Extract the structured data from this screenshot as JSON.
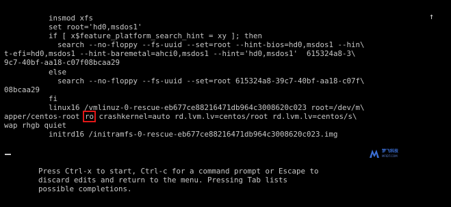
{
  "boot_editor": {
    "lines": [
      "          insmod xfs",
      "          set root='hd0,msdos1'",
      "          if [ x$feature_platform_search_hint = xy ]; then",
      "            search --no-floppy --fs-uuid --set=root --hint-bios=hd0,msdos1 --hin\\",
      "t-efi=hd0,msdos1 --hint-baremetal=ahci0,msdos1 --hint='hd0,msdos1'  615324a8-3\\",
      "9c7-40bf-aa18-c07f08bcaa29",
      "          else",
      "            search --no-floppy --fs-uuid --set=root 615324a8-39c7-40bf-aa18-c07f\\",
      "08bcaa29",
      "          fi",
      "          linux16 /vmlinuz-0-rescue-eb677ce88216471db964c3008620c023 root=/dev/m\\"
    ],
    "highlight_line": {
      "prefix": "apper/centos-root ",
      "highlighted": "ro",
      "suffix": " crashkernel=auto rd.lvm.lv=centos/root rd.lvm.lv=centos/s\\"
    },
    "after_lines": [
      "wap rhgb quiet",
      "          initrd16 /initramfs-0-rescue-eb677ce88216471db964c3008620c023.img"
    ]
  },
  "scroll_indicator": "↑",
  "help_lines": [
    "Press Ctrl-x to start, Ctrl-c for a command prompt or Escape to",
    "discard edits and return to the menu. Pressing Tab lists",
    "possible completions."
  ],
  "watermark": {
    "title": "梦飞科技",
    "subtitle": "MFIDT.COM"
  },
  "colors": {
    "background": "#000000",
    "text": "#c8c8c8",
    "highlight_box": "#e21818"
  }
}
